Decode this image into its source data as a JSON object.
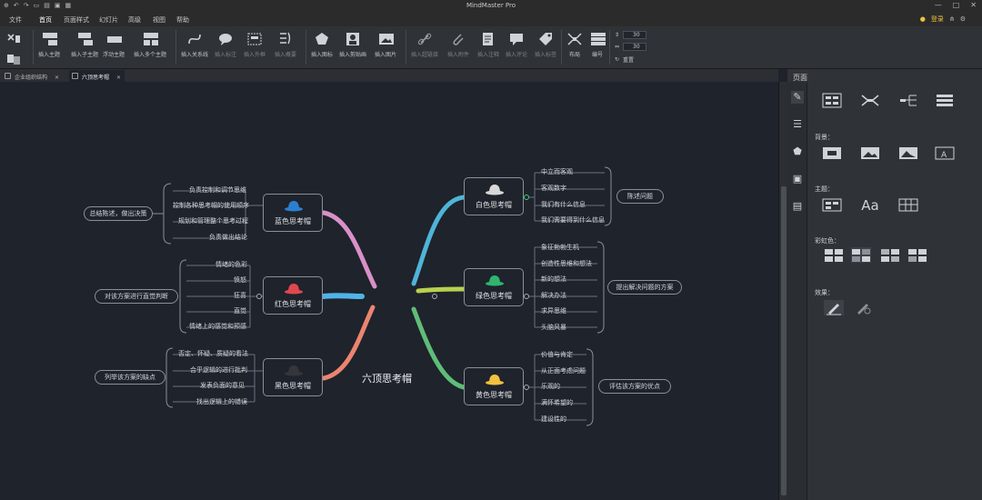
{
  "app": {
    "title": "MindMaster Pro"
  },
  "menu": {
    "items": [
      "文件",
      "首页",
      "页面样式",
      "幻灯片",
      "高级",
      "视图",
      "帮助"
    ],
    "login": "登录"
  },
  "ribbon": {
    "buttons": [
      "插入主题",
      "插入子主题",
      "浮动主题",
      "插入多个主题",
      "插入关系线",
      "插入标注",
      "插入外框",
      "插入概要",
      "插入图标",
      "插入剪贴画",
      "插入图片",
      "插入超链接",
      "插入附件",
      "插入注释",
      "插入评论",
      "插入标签",
      "布局",
      "编号"
    ],
    "spin1": "30",
    "spin2": "30",
    "reset": "重置"
  },
  "tabs": [
    "企业组织结构",
    "六顶思考帽"
  ],
  "panel": {
    "title": "页面",
    "background_label": "背景：",
    "theme_label": "主题：",
    "rainbow_label": "彩虹色：",
    "effect_label": "效果："
  },
  "mindmap": {
    "center": "六顶思考帽",
    "hats": {
      "blue": {
        "label": "蓝色思考帽",
        "color": "#2b7fd0",
        "items": [
          "负责控制和调节思维",
          "控制各种思考帽的使用顺序",
          "规划和管理整个思考过程",
          "负责做出结论"
        ],
        "summary": "总结陈述，做出决策"
      },
      "red": {
        "label": "红色思考帽",
        "color": "#e04850",
        "items": [
          "情绪的色彩",
          "愤怒",
          "狂喜",
          "直觉",
          "情绪上的感觉和预感"
        ],
        "summary": "对该方案进行直觉判断"
      },
      "black": {
        "label": "黑色思考帽",
        "color": "#2e3036",
        "items": [
          "否定、怀疑、质疑的看法",
          "合乎逻辑的进行批判",
          "发表负面的意见",
          "找出逻辑上的错误"
        ],
        "summary": "列举该方案的缺点"
      },
      "white": {
        "label": "白色思考帽",
        "color": "#d8d8d8",
        "items": [
          "中立而客观",
          "客观数字",
          "我们有什么信息",
          "我们需要得到什么信息"
        ],
        "summary": "陈述问题"
      },
      "green": {
        "label": "绿色思考帽",
        "color": "#2fb56e",
        "items": [
          "象征勃勃生机",
          "创造性思维和想法",
          "新的想法",
          "解决办法",
          "求异思维",
          "头脑风暴"
        ],
        "summary": "提出解决问题的方案"
      },
      "yellow": {
        "label": "黄色思考帽",
        "color": "#f0c040",
        "items": [
          "价值与肯定",
          "从正面考虑问题",
          "乐观的",
          "满怀希望的",
          "建设性的"
        ],
        "summary": "评估该方案的优点"
      }
    }
  }
}
